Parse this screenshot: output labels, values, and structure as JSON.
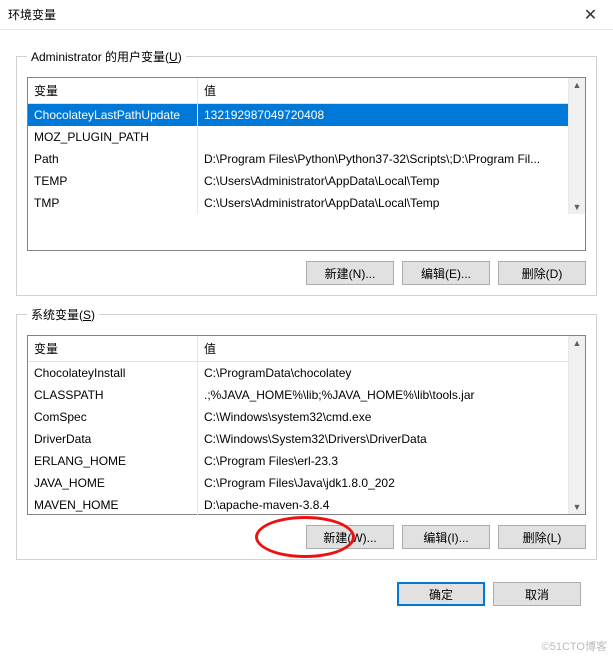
{
  "title": "环境变量",
  "user_section_label_pre": "Administrator 的用户变量(",
  "user_section_label_ul": "U",
  "user_section_label_post": ")",
  "system_section_label_pre": "系统变量(",
  "system_section_label_ul": "S",
  "system_section_label_post": ")",
  "col_var": "变量",
  "col_val": "值",
  "user_vars": [
    {
      "name": "ChocolateyLastPathUpdate",
      "value": "132192987049720408",
      "selected": true
    },
    {
      "name": "MOZ_PLUGIN_PATH",
      "value": ""
    },
    {
      "name": "Path",
      "value": "D:\\Program Files\\Python\\Python37-32\\Scripts\\;D:\\Program Fil..."
    },
    {
      "name": "TEMP",
      "value": "C:\\Users\\Administrator\\AppData\\Local\\Temp"
    },
    {
      "name": "TMP",
      "value": "C:\\Users\\Administrator\\AppData\\Local\\Temp"
    }
  ],
  "system_vars": [
    {
      "name": "ChocolateyInstall",
      "value": "C:\\ProgramData\\chocolatey"
    },
    {
      "name": "CLASSPATH",
      "value": ".;%JAVA_HOME%\\lib;%JAVA_HOME%\\lib\\tools.jar"
    },
    {
      "name": "ComSpec",
      "value": "C:\\Windows\\system32\\cmd.exe"
    },
    {
      "name": "DriverData",
      "value": "C:\\Windows\\System32\\Drivers\\DriverData"
    },
    {
      "name": "ERLANG_HOME",
      "value": "C:\\Program Files\\erl-23.3"
    },
    {
      "name": "JAVA_HOME",
      "value": "C:\\Program Files\\Java\\jdk1.8.0_202"
    },
    {
      "name": "MAVEN_HOME",
      "value": "D:\\apache-maven-3.8.4"
    }
  ],
  "user_btns": {
    "new": "新建(N)...",
    "edit": "编辑(E)...",
    "del": "删除(D)"
  },
  "sys_btns": {
    "new": "新建(W)...",
    "edit": "编辑(I)...",
    "del": "删除(L)"
  },
  "footer_btns": {
    "ok": "确定",
    "cancel": "取消"
  },
  "watermark": "©51CTO博客"
}
